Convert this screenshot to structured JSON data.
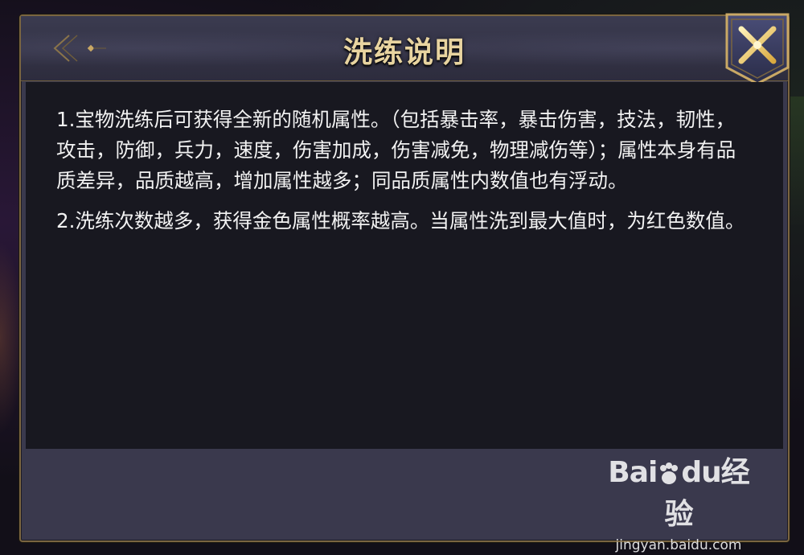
{
  "dialog": {
    "title": "洗练说明",
    "paragraphs": [
      "1.宝物洗练后可获得全新的随机属性。（包括暴击率，暴击伤害，技法，韧性，攻击，防御，兵力，速度，伤害加成，伤害减免，物理减伤等）；属性本身有品质差异，品质越高，增加属性越多；同品质属性内数值也有浮动。",
      "2.洗练次数越多，获得金色属性概率越高。当属性洗到最大值时，为红色数值。"
    ],
    "close_icon": "close-x-icon",
    "ornament_icon": "back-arrow-ornament-icon"
  },
  "watermark": {
    "logo_bai": "Bai",
    "logo_du": "du",
    "logo_suffix": "经验",
    "url": "jingyan.baidu.com"
  },
  "colors": {
    "title": "#e8d4a0",
    "frame_gold": "#7a6540",
    "content_bg": "#181820",
    "panel_bg": "#3a394d",
    "text": "#f2f2f2"
  }
}
